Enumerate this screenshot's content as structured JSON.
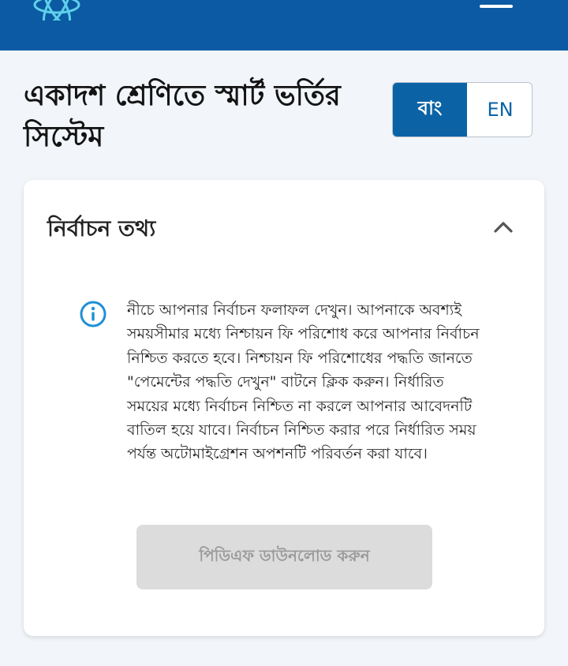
{
  "header": {
    "logo_icon": "atom-logo-icon",
    "menu_icon": "hamburger-menu-icon",
    "background_color": "#0b5aa3"
  },
  "page": {
    "title": "একাদশ শ্রেণিতে স্মার্ট ভর্তির সিস্টেম"
  },
  "language_toggle": {
    "bangla_label": "বাং",
    "english_label": "EN",
    "selected": "বাং",
    "active_color": "#0b63a6"
  },
  "selection_info": {
    "title": "নির্বাচন তথ্য",
    "toggle_icon": "chevron-up-icon",
    "info_icon": "info-circle-icon",
    "info_color": "#1f8fd6",
    "notice_text": "নীচে আপনার নির্বাচন ফলাফল দেখুন। আপনাকে অবশ্যই সময়সীমার মধ্যে নিশ্চায়ন ফি পরিশোধ করে আপনার নির্বাচন নিশ্চিত করতে হবে। নিশ্চায়ন ফি পরিশোধের পদ্ধতি জানতে \"পেমেন্টের পদ্ধতি দেখুন\" বাটনে ক্লিক করুন। নির্ধারিত সময়ের মধ্যে নির্বাচন নিশ্চিত না করলে আপনার আবেদনটি বাতিল হয়ে যাবে। নির্বাচন নিশ্চিত করার পরে নির্ধারিত সময় পর্যন্ত অটোমাইগ্রেশন অপশনটি পরিবর্তন করা যাবে।",
    "pdf_button_label": "পিডিএফ ডাউনলোড করুন"
  }
}
